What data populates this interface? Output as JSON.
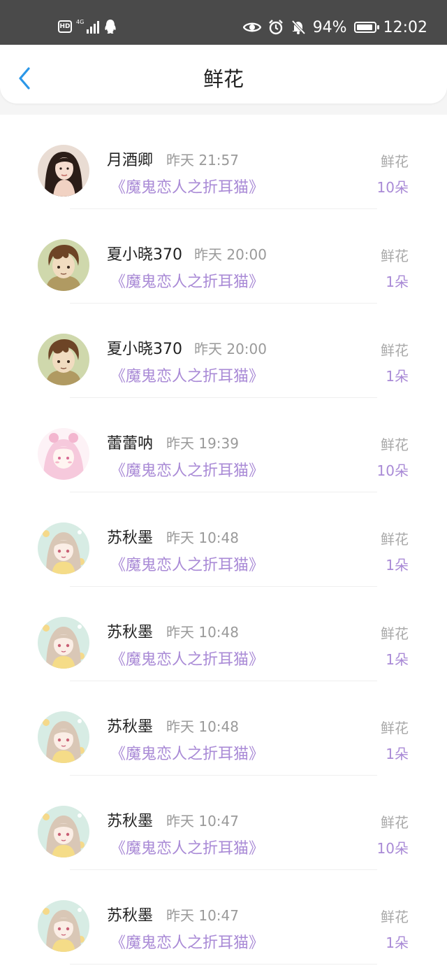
{
  "status_bar": {
    "hd_label": "HD",
    "network_label": "4G",
    "battery_percent_text": "94%",
    "battery_level": 0.94,
    "time": "12:02",
    "icons": [
      "hd-icon",
      "signal-icon",
      "qq-icon",
      "eye-icon",
      "alarm-icon",
      "mute-bell-icon",
      "battery-icon"
    ]
  },
  "header": {
    "title": "鲜花",
    "back_icon": "chevron-left-icon"
  },
  "colors": {
    "accent": "#2b97e8",
    "book_purple": "#a98ad6",
    "status_bar_bg": "#4a4a4a"
  },
  "list": {
    "rows": [
      {
        "name": "月酒卿",
        "time": "昨天 21:57",
        "book": "《魔鬼恋人之折耳猫》",
        "gift_label": "鲜花",
        "gift_count": "10朵",
        "avatar": "portrait-avatar"
      },
      {
        "name": "夏小晓370",
        "time": "昨天 20:00",
        "book": "《魔鬼恋人之折耳猫》",
        "gift_label": "鲜花",
        "gift_count": "1朵",
        "avatar": "anime-boy-avatar"
      },
      {
        "name": "夏小晓370",
        "time": "昨天 20:00",
        "book": "《魔鬼恋人之折耳猫》",
        "gift_label": "鲜花",
        "gift_count": "1朵",
        "avatar": "anime-boy-avatar"
      },
      {
        "name": "蕾蕾呐",
        "time": "昨天 19:39",
        "book": "《魔鬼恋人之折耳猫》",
        "gift_label": "鲜花",
        "gift_count": "10朵",
        "avatar": "anime-pink-girl-avatar"
      },
      {
        "name": "苏秋墨",
        "time": "昨天 10:48",
        "book": "《魔鬼恋人之折耳猫》",
        "gift_label": "鲜花",
        "gift_count": "1朵",
        "avatar": "anime-girl-avatar"
      },
      {
        "name": "苏秋墨",
        "time": "昨天 10:48",
        "book": "《魔鬼恋人之折耳猫》",
        "gift_label": "鲜花",
        "gift_count": "1朵",
        "avatar": "anime-girl-avatar"
      },
      {
        "name": "苏秋墨",
        "time": "昨天 10:48",
        "book": "《魔鬼恋人之折耳猫》",
        "gift_label": "鲜花",
        "gift_count": "1朵",
        "avatar": "anime-girl-avatar"
      },
      {
        "name": "苏秋墨",
        "time": "昨天 10:47",
        "book": "《魔鬼恋人之折耳猫》",
        "gift_label": "鲜花",
        "gift_count": "10朵",
        "avatar": "anime-girl-avatar"
      },
      {
        "name": "苏秋墨",
        "time": "昨天 10:47",
        "book": "《魔鬼恋人之折耳猫》",
        "gift_label": "鲜花",
        "gift_count": "1朵",
        "avatar": "anime-girl-avatar"
      }
    ]
  }
}
